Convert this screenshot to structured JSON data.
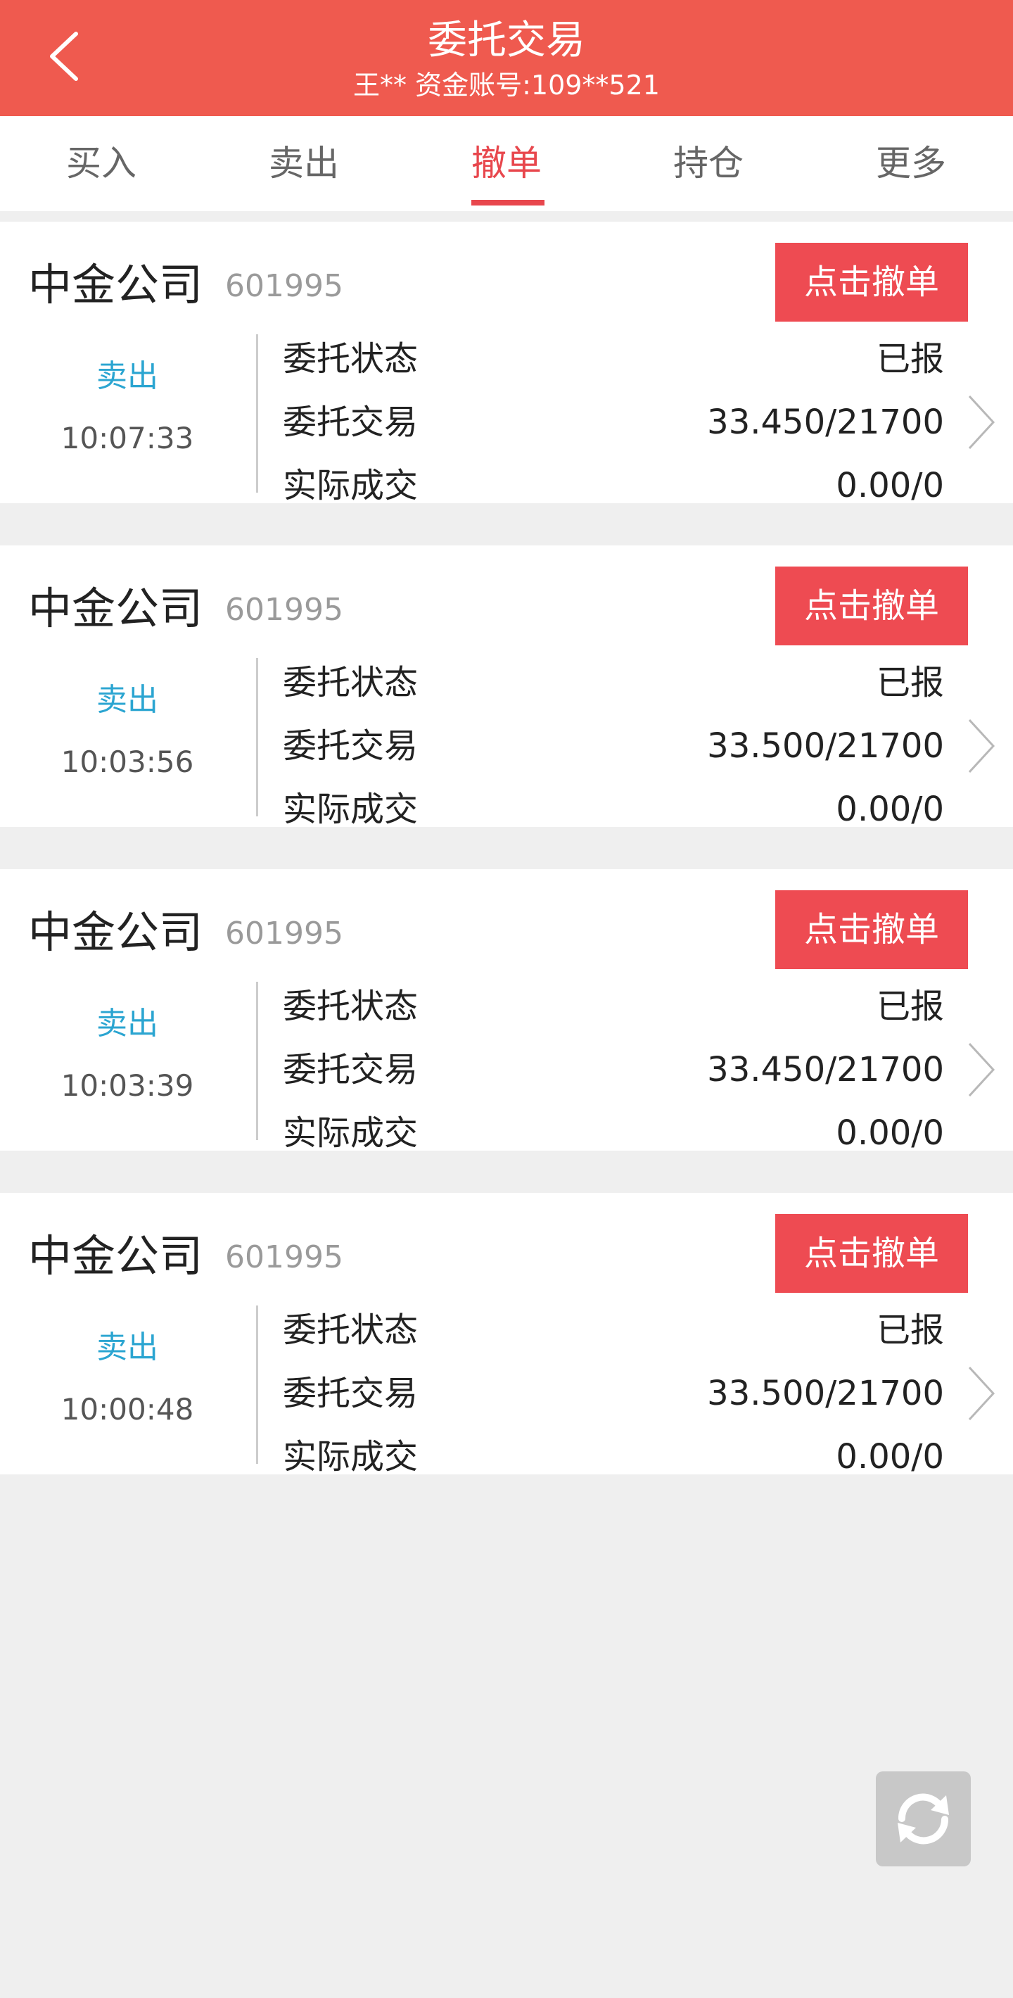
{
  "header": {
    "title": "委托交易",
    "subtitle": "王**  资金账号:109**521"
  },
  "tabs": [
    {
      "label": "买入"
    },
    {
      "label": "卖出"
    },
    {
      "label": "撤单"
    },
    {
      "label": "持仓"
    },
    {
      "label": "更多"
    }
  ],
  "active_tab": "撤单",
  "orders": [
    {
      "name": "中金公司",
      "code": "601995",
      "button": "点击撤单",
      "side": "卖出",
      "time": "10:07:33",
      "status_label": "委托状态",
      "status_value": "已报",
      "entrust_label": "委托交易",
      "entrust_value": "33.450/21700",
      "deal_label": "实际成交",
      "deal_value": "0.00/0"
    },
    {
      "name": "中金公司",
      "code": "601995",
      "button": "点击撤单",
      "side": "卖出",
      "time": "10:03:56",
      "status_label": "委托状态",
      "status_value": "已报",
      "entrust_label": "委托交易",
      "entrust_value": "33.500/21700",
      "deal_label": "实际成交",
      "deal_value": "0.00/0"
    },
    {
      "name": "中金公司",
      "code": "601995",
      "button": "点击撤单",
      "side": "卖出",
      "time": "10:03:39",
      "status_label": "委托状态",
      "status_value": "已报",
      "entrust_label": "委托交易",
      "entrust_value": "33.450/21700",
      "deal_label": "实际成交",
      "deal_value": "0.00/0"
    },
    {
      "name": "中金公司",
      "code": "601995",
      "button": "点击撤单",
      "side": "卖出",
      "time": "10:00:48",
      "status_label": "委托状态",
      "status_value": "已报",
      "entrust_label": "委托交易",
      "entrust_value": "33.500/21700",
      "deal_label": "实际成交",
      "deal_value": "0.00/0"
    }
  ],
  "colors": {
    "header_bg": "#ef5a4f",
    "accent": "#e8474d",
    "cancel_button": "#ee4b52",
    "side_sell": "#2ba5d1",
    "page_bg": "#efefef"
  },
  "icons": {
    "back": "chevron-left-icon",
    "row_arrow": "chevron-right-icon",
    "refresh": "refresh-icon"
  }
}
